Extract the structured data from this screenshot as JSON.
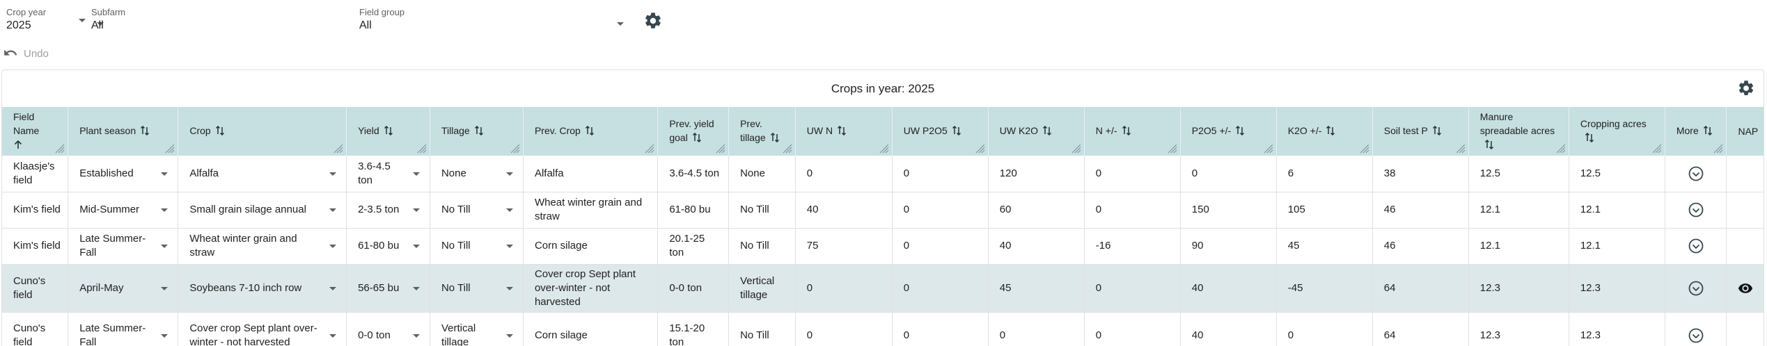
{
  "filters": {
    "crop_year": {
      "label": "Crop year",
      "value": "2025"
    },
    "subfarm": {
      "label": "Subfarm",
      "value": "All"
    },
    "field_group": {
      "label": "Field group",
      "value": "All"
    }
  },
  "undo_label": "Undo",
  "table_title": "Crops in year: 2025",
  "columns": [
    "Field Name",
    "Plant season",
    "Crop",
    "Yield",
    "Tillage",
    "Prev. Crop",
    "Prev. yield goal",
    "Prev. tillage",
    "UW N",
    "UW P2O5",
    "UW K2O",
    "N +/-",
    "P2O5 +/-",
    "K2O +/-",
    "Soil test P",
    "Manure spreadable acres",
    "Cropping acres",
    "More",
    "NAP"
  ],
  "rows": [
    {
      "field": "Klaasje's field",
      "season": "Established",
      "crop": "Alfalfa",
      "yield": "3.6-4.5 ton",
      "tillage": "None",
      "prev_crop": "Alfalfa",
      "prev_yield": "3.6-4.5 ton",
      "prev_tillage": "None",
      "uw_n": "0",
      "uw_p2o5": "0",
      "uw_k2o": "120",
      "n_pm": "0",
      "p2o5_pm": "0",
      "k2o_pm": "6",
      "soil_p": "38",
      "manure_acres": "12.5",
      "crop_acres": "12.5"
    },
    {
      "field": "Kim's field",
      "season": "Mid-Summer",
      "crop": "Small grain silage annual",
      "yield": "2-3.5 ton",
      "tillage": "No Till",
      "prev_crop": "Wheat winter grain and straw",
      "prev_yield": "61-80 bu",
      "prev_tillage": "No Till",
      "uw_n": "40",
      "uw_p2o5": "0",
      "uw_k2o": "60",
      "n_pm": "0",
      "p2o5_pm": "150",
      "k2o_pm": "105",
      "soil_p": "46",
      "manure_acres": "12.1",
      "crop_acres": "12.1"
    },
    {
      "field": "Kim's field",
      "season": "Late Summer-Fall",
      "crop": "Wheat winter grain and straw",
      "yield": "61-80 bu",
      "tillage": "No Till",
      "prev_crop": "Corn silage",
      "prev_yield": "20.1-25 ton",
      "prev_tillage": "No Till",
      "uw_n": "75",
      "uw_p2o5": "0",
      "uw_k2o": "40",
      "n_pm": "-16",
      "p2o5_pm": "90",
      "k2o_pm": "45",
      "soil_p": "46",
      "manure_acres": "12.1",
      "crop_acres": "12.1"
    },
    {
      "field": "Cuno's field",
      "season": "April-May",
      "crop": "Soybeans 7-10 inch row",
      "yield": "56-65 bu",
      "tillage": "No Till",
      "prev_crop": "Cover crop Sept plant over-winter - not harvested",
      "prev_yield": "0-0 ton",
      "prev_tillage": "Vertical tillage",
      "uw_n": "0",
      "uw_p2o5": "0",
      "uw_k2o": "45",
      "n_pm": "0",
      "p2o5_pm": "40",
      "k2o_pm": "-45",
      "soil_p": "64",
      "manure_acres": "12.3",
      "crop_acres": "12.3"
    },
    {
      "field": "Cuno's field",
      "season": "Late Summer-Fall",
      "crop": "Cover crop Sept plant over-winter - not harvested",
      "yield": "0-0 ton",
      "tillage": "Vertical tillage",
      "prev_crop": "Corn silage",
      "prev_yield": "15.1-20 ton",
      "prev_tillage": "No Till",
      "uw_n": "0",
      "uw_p2o5": "0",
      "uw_k2o": "0",
      "n_pm": "0",
      "p2o5_pm": "40",
      "k2o_pm": "0",
      "soil_p": "64",
      "manure_acres": "12.3",
      "crop_acres": "12.3"
    }
  ],
  "icons": {
    "settings": "gear-icon",
    "undo": "undo-icon",
    "sort": "sort-arrows-icon",
    "sort_asc": "arrow-up-icon",
    "expand": "chevron-down-circle-icon",
    "nap": "eye-icon",
    "resize": "resize-grip-icon"
  },
  "colors": {
    "header_bg": "#c6dfe0",
    "highlight_row_bg": "#dde8ea",
    "icon": "#37474f"
  }
}
